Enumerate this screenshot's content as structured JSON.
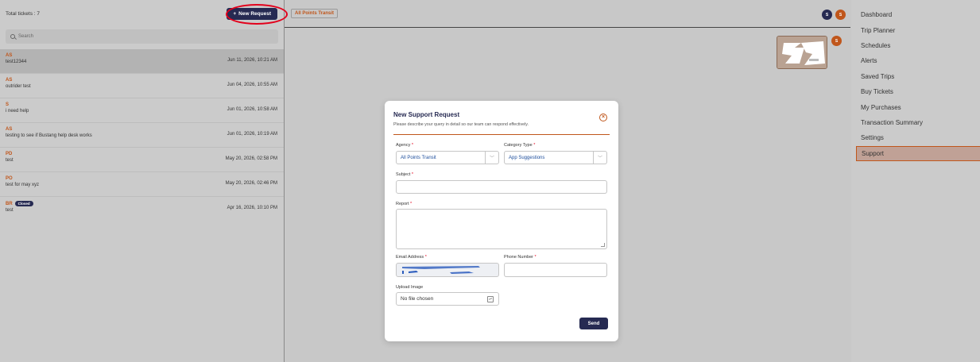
{
  "left_panel": {
    "total_label": "Total tickets : 7",
    "new_request_label": "New Request",
    "search_placeholder": "Search",
    "tickets": [
      {
        "initials": "AS",
        "subject": "test12344",
        "date": "Jun 11, 2026, 10:21 AM",
        "badge": ""
      },
      {
        "initials": "AS",
        "subject": "outrider test",
        "date": "Jun 04, 2026, 10:55 AM",
        "badge": ""
      },
      {
        "initials": "S",
        "subject": "i need help",
        "date": "Jun 01, 2026, 10:58 AM",
        "badge": ""
      },
      {
        "initials": "AS",
        "subject": "testing to see if Bustang help desk works",
        "date": "Jun 01, 2026, 10:19 AM",
        "badge": ""
      },
      {
        "initials": "PD",
        "subject": "test",
        "date": "May 20, 2026, 02:58 PM",
        "badge": ""
      },
      {
        "initials": "PO",
        "subject": "test for may xyz",
        "date": "May 20, 2026, 02:46 PM",
        "badge": ""
      },
      {
        "initials": "BR",
        "subject": "test",
        "date": "Apr 16, 2026, 10:10 PM",
        "badge": "Closed"
      }
    ]
  },
  "header": {
    "agency_tag": "All Points Transit",
    "avatars": [
      "S",
      "S"
    ],
    "thumb_avatar": "S"
  },
  "nav": {
    "items": [
      "Dashboard",
      "Trip Planner",
      "Schedules",
      "Alerts",
      "Saved Trips",
      "Buy Tickets",
      "My Purchases",
      "Transaction Summary",
      "Settings",
      "Support"
    ],
    "active": "Support"
  },
  "modal": {
    "title": "New Support Request",
    "subtitle": "Please describe your query in detail so our team can respond effectively.",
    "agency_label": "Agency",
    "agency_value": "All Points Transit",
    "category_label": "Category Type",
    "category_value": "App Suggestions",
    "subject_label": "Subject",
    "subject_value": "",
    "report_label": "Report",
    "report_value": "",
    "email_label": "Email Address",
    "phone_label": "Phone Number",
    "phone_value": "",
    "upload_label": "Upload Image",
    "upload_value": "No file chosen",
    "required_mark": "*",
    "send_label": "Send"
  },
  "colors": {
    "navy": "#262a52",
    "accent_orange": "#c0561b",
    "highlight_red": "#e3001b"
  }
}
